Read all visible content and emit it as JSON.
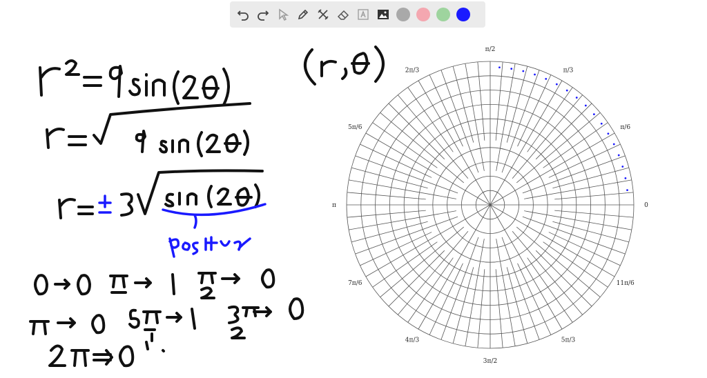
{
  "toolbar": {
    "tools": [
      {
        "name": "undo-icon"
      },
      {
        "name": "redo-icon"
      },
      {
        "name": "pointer-icon"
      },
      {
        "name": "pen-icon"
      },
      {
        "name": "tools-icon"
      },
      {
        "name": "eraser-icon"
      },
      {
        "name": "text-icon"
      },
      {
        "name": "image-icon"
      }
    ],
    "colors": [
      "#a9a9a9",
      "#f4a7b0",
      "#9ed49e",
      "#1a1aff"
    ]
  },
  "polar": {
    "angle_labels": [
      "0",
      "π/6",
      "π/3",
      "π/2",
      "2π/3",
      "5π/6",
      "π",
      "7π/6",
      "4π/3",
      "3π/2",
      "5π/3",
      "11π/6"
    ]
  },
  "colors": {
    "ink": "#111111",
    "accent": "#1a1aff"
  }
}
